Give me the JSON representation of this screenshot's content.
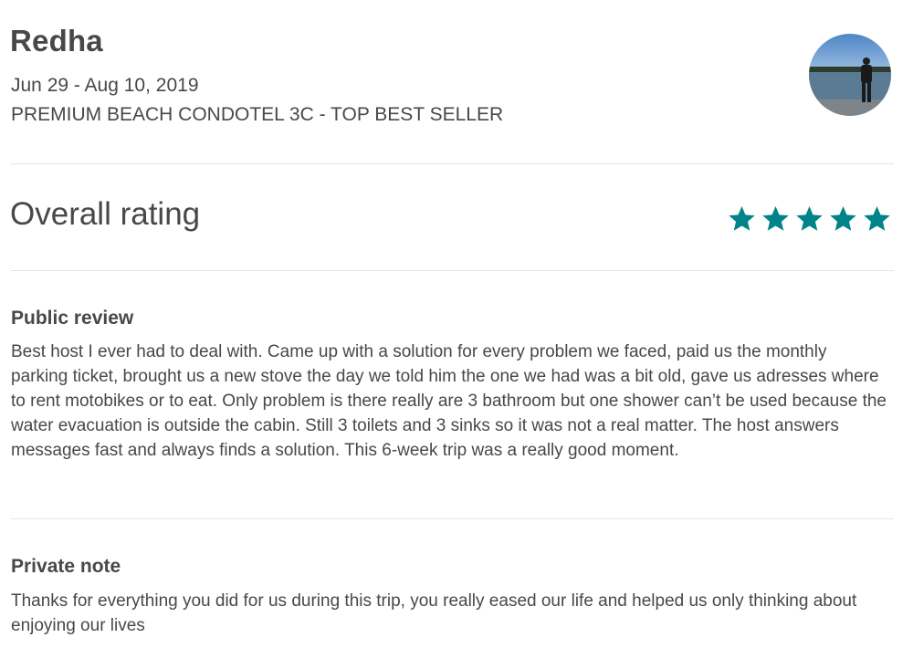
{
  "review": {
    "guest_name": "Redha",
    "dates": "Jun 29 - Aug 10, 2019",
    "listing": "PREMIUM BEACH CONDOTEL 3C - TOP BEST SELLER",
    "avatar_icon": "guest-avatar-photo"
  },
  "rating": {
    "label": "Overall rating",
    "stars": 5,
    "max_stars": 5,
    "star_color": "#008489"
  },
  "public_review": {
    "heading": "Public review",
    "text": "Best host I ever had to deal with. Came up with a solution for every problem we faced, paid us the monthly parking ticket, brought us a new stove the day we told him the one we had was a bit old, gave us adresses where to rent motobikes or to eat. Only problem is there really are 3 bathroom but one shower can’t be used because the water evacuation is outside the cabin. Still 3 toilets and 3 sinks so it was not a real matter. The host answers messages fast and always finds a solution. This 6-week trip was a really good moment."
  },
  "private_note": {
    "heading": "Private note",
    "text": "Thanks for everything you did for us during this trip, you really eased our life and helped us only thinking about enjoying our lives"
  },
  "colors": {
    "text": "#484848",
    "divider": "#e4e4e4",
    "accent": "#008489"
  }
}
